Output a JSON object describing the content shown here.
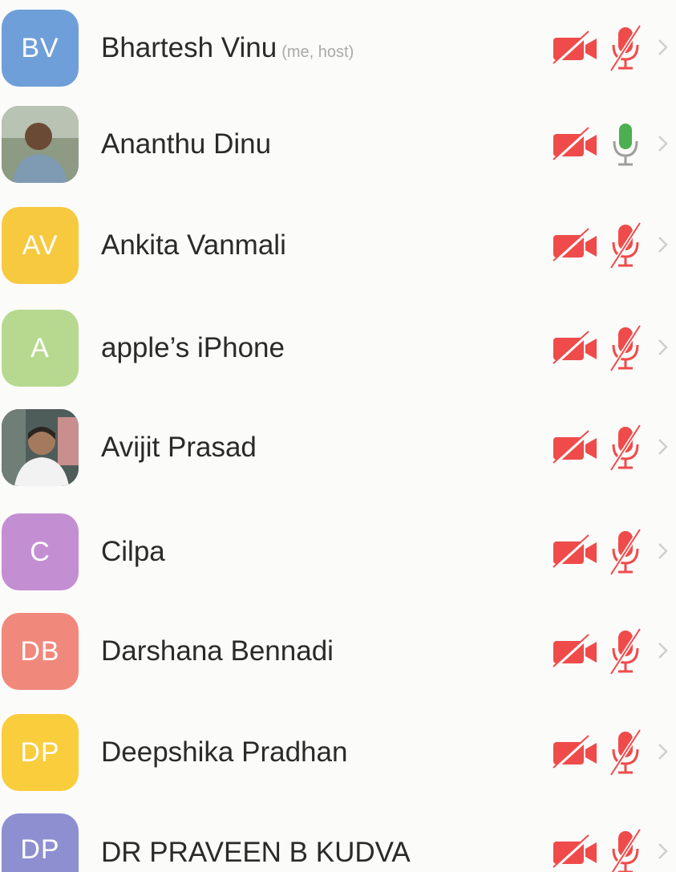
{
  "participants": [
    {
      "initials": "BV",
      "name": "Bhartesh Vinu",
      "subtitle": "(me, host)",
      "avatar_color": "#6f9fd8",
      "avatar_type": "initials",
      "video": "off",
      "audio": "muted"
    },
    {
      "initials": "",
      "name": "Ananthu Dinu",
      "subtitle": "",
      "avatar_color": "#7a8872",
      "avatar_type": "photo",
      "video": "off",
      "audio": "on"
    },
    {
      "initials": "AV",
      "name": "Ankita Vanmali",
      "subtitle": "",
      "avatar_color": "#f7c93f",
      "avatar_type": "initials",
      "video": "off",
      "audio": "muted"
    },
    {
      "initials": "A",
      "name": "apple’s iPhone",
      "subtitle": "",
      "avatar_color": "#b7d98f",
      "avatar_type": "initials",
      "video": "off",
      "audio": "muted"
    },
    {
      "initials": "",
      "name": "Avijit Prasad",
      "subtitle": "",
      "avatar_color": "#5d6a68",
      "avatar_type": "photo",
      "video": "off",
      "audio": "muted"
    },
    {
      "initials": "C",
      "name": "Cilpa",
      "subtitle": "",
      "avatar_color": "#c48fd2",
      "avatar_type": "initials",
      "video": "off",
      "audio": "muted"
    },
    {
      "initials": "DB",
      "name": "Darshana Bennadi",
      "subtitle": "",
      "avatar_color": "#f0887c",
      "avatar_type": "initials",
      "video": "off",
      "audio": "muted"
    },
    {
      "initials": "DP",
      "name": "Deepshika Pradhan",
      "subtitle": "",
      "avatar_color": "#f9cd3c",
      "avatar_type": "initials",
      "video": "off",
      "audio": "muted"
    },
    {
      "initials": "DP",
      "name": "DR PRAVEEN B KUDVA",
      "subtitle": "",
      "avatar_color": "#8d8fd1",
      "avatar_type": "initials",
      "video": "off",
      "audio": "muted"
    }
  ],
  "colors": {
    "muted_red": "#ef4b4b",
    "mic_on_green": "#4caf50",
    "chevron_gray": "#cfcfcf"
  }
}
